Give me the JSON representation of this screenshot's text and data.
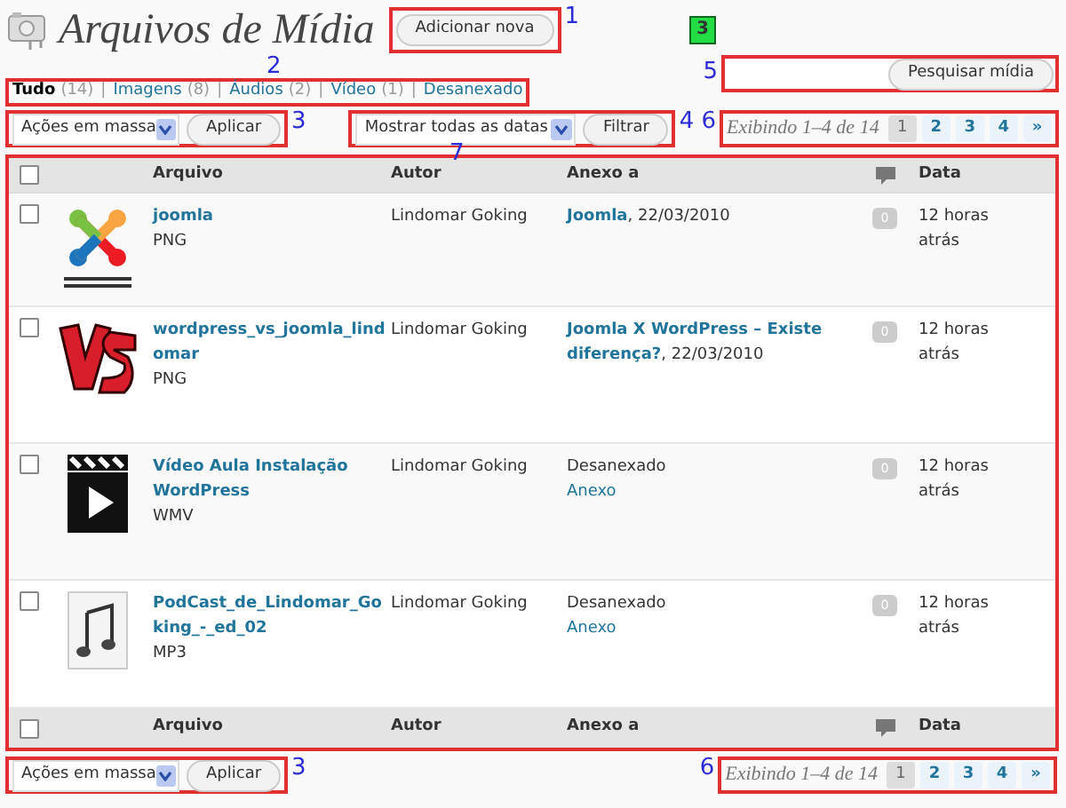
{
  "header": {
    "title": "Arquivos de Mídia",
    "add_button": "Adicionar nova",
    "annotation": "1",
    "badge": "3"
  },
  "filters": {
    "annotation": "2",
    "separator": "|",
    "items": [
      {
        "label": "Tudo",
        "count": "(14)",
        "selected": true
      },
      {
        "label": "Imagens",
        "count": "(8)",
        "selected": false
      },
      {
        "label": "Áudios",
        "count": "(2)",
        "selected": false
      },
      {
        "label": "Vídeo",
        "count": "(1)",
        "selected": false
      },
      {
        "label": "Desanexado",
        "selected": false
      }
    ]
  },
  "search": {
    "button": "Pesquisar mídia",
    "annotation": "5"
  },
  "top_actions": {
    "bulk": "Ações em massa",
    "apply": "Aplicar",
    "annotation": "3",
    "date_filter": "Mostrar todas as datas",
    "filter_button": "Filtrar",
    "filter_annotation": "4"
  },
  "pagination_top": {
    "annotation": "6",
    "summary": "Exibindo 1–4 de 14",
    "pages": [
      {
        "label": "1",
        "selected": true
      },
      {
        "label": "2",
        "selected": false
      },
      {
        "label": "3",
        "selected": false
      },
      {
        "label": "4",
        "selected": false
      },
      {
        "label": "»",
        "selected": false
      }
    ]
  },
  "table": {
    "annotation": "7",
    "select_all_checked": false,
    "columns": [
      "Arquivo",
      "Autor",
      "Anexo a",
      "Data"
    ],
    "rows": [
      {
        "kind": "joomla",
        "file": "joomla",
        "type": "PNG",
        "author": "Lindomar Goking",
        "attached": {
          "kind": "post",
          "text": "**Joomla**, 22/03/2010"
        },
        "comments": "0",
        "date": "12 horas atrás",
        "checked": false
      },
      {
        "kind": "vs",
        "file": "wordpress_vs_joomla_lindomar",
        "type": "PNG",
        "author": "Lindomar Goking",
        "attached": {
          "kind": "post",
          "text": "**Joomla X WordPress – Existe diferença?**, 22/03/2010"
        },
        "comments": "0",
        "date": "12 horas atrás",
        "checked": false
      },
      {
        "kind": "video",
        "file": "Vídeo Aula Instalação WordPress",
        "type": "WMV",
        "author": "Lindomar Goking",
        "attached": {
          "kind": "none",
          "status": "Desanexado",
          "link": "Anexo"
        },
        "comments": "0",
        "date": "12 horas atrás",
        "checked": false
      },
      {
        "kind": "audio",
        "file": "PodCast_de_Lindomar_Goking_-_ed_02",
        "type": "MP3",
        "author": "Lindomar Goking",
        "attached": {
          "kind": "none",
          "status": "Desanexado",
          "link": "Anexo"
        },
        "comments": "0",
        "date": "12 horas atrás",
        "checked": false
      }
    ],
    "footer_checked": false,
    "footer_columns": [
      "Arquivo",
      "Autor",
      "Anexo a",
      "Data"
    ]
  },
  "bottom_actions": {
    "bulk": "Ações em massa",
    "apply": "Aplicar",
    "annotation": "3"
  },
  "pagination_bottom": {
    "annotation": "6",
    "summary": "Exibindo 1–4 de 14",
    "pages": [
      {
        "label": "1",
        "selected": true
      },
      {
        "label": "2",
        "selected": false
      },
      {
        "label": "3",
        "selected": false
      },
      {
        "label": "4",
        "selected": false
      },
      {
        "label": "»",
        "selected": false
      }
    ]
  }
}
